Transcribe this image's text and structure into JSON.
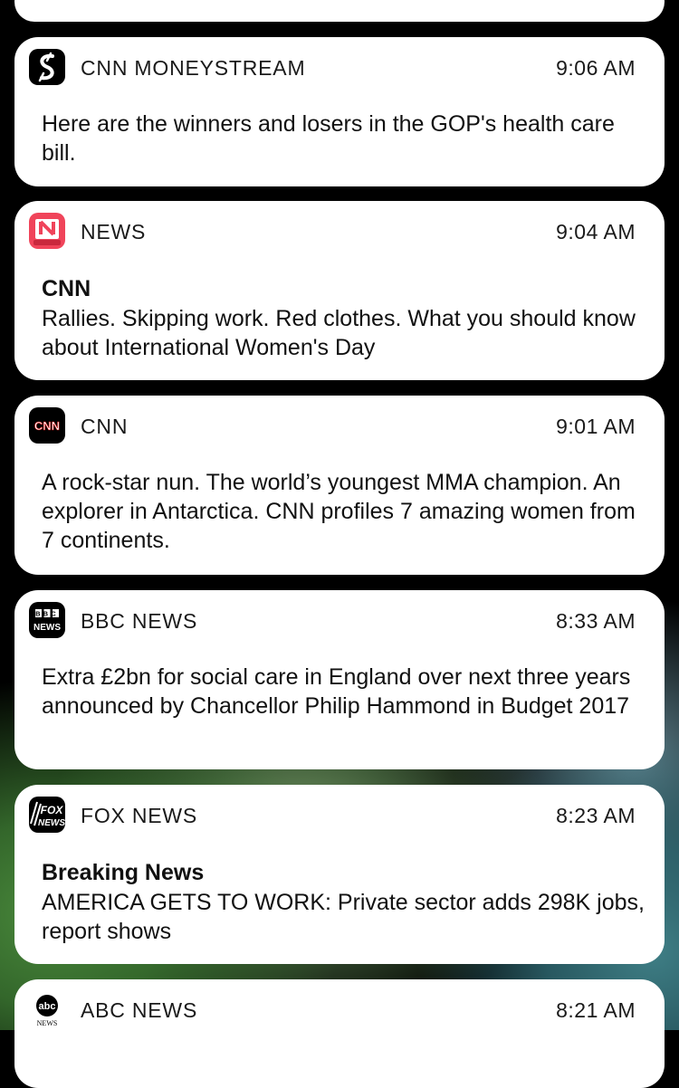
{
  "notifications": [
    {
      "app": "CNN MONEYSTREAM",
      "time": "9:06 AM",
      "title": "",
      "body": "Here are the winners and losers in the GOP's health care bill.",
      "icon": "moneystream-icon"
    },
    {
      "app": "NEWS",
      "time": "9:04 AM",
      "title": "CNN",
      "body": "Rallies. Skipping work. Red clothes. What you should know about International Women's Day",
      "icon": "apple-news-icon"
    },
    {
      "app": "CNN",
      "time": "9:01 AM",
      "title": "",
      "body": "A rock-star nun. The world’s youngest MMA champion. An explorer in Antarctica. CNN profiles 7 amazing women from 7 continents.",
      "icon": "cnn-icon"
    },
    {
      "app": "BBC NEWS",
      "time": "8:33 AM",
      "title": "",
      "body": "Extra £2bn for social care in England over next three years announced by Chancellor Philip Hammond in Budget 2017",
      "icon": "bbc-news-icon"
    },
    {
      "app": "FOX NEWS",
      "time": "8:23 AM",
      "title": "Breaking News",
      "body": "AMERICA GETS TO WORK: Private sector adds 298K jobs, report shows",
      "icon": "fox-news-icon"
    },
    {
      "app": "ABC NEWS",
      "time": "8:21 AM",
      "title": "",
      "body": "",
      "icon": "abc-news-icon"
    }
  ],
  "icon_text": {
    "bbc_top": "BBC",
    "bbc_bottom": "NEWS",
    "fox_top": "FOX",
    "fox_bottom": "NEWS",
    "abc_top": "abc",
    "abc_bottom": "NEWS",
    "cnn": "CNN"
  },
  "colors": {
    "card_background": "#ffffff",
    "news_icon_red": "#f0445a",
    "cnn_red": "#cc0000"
  }
}
